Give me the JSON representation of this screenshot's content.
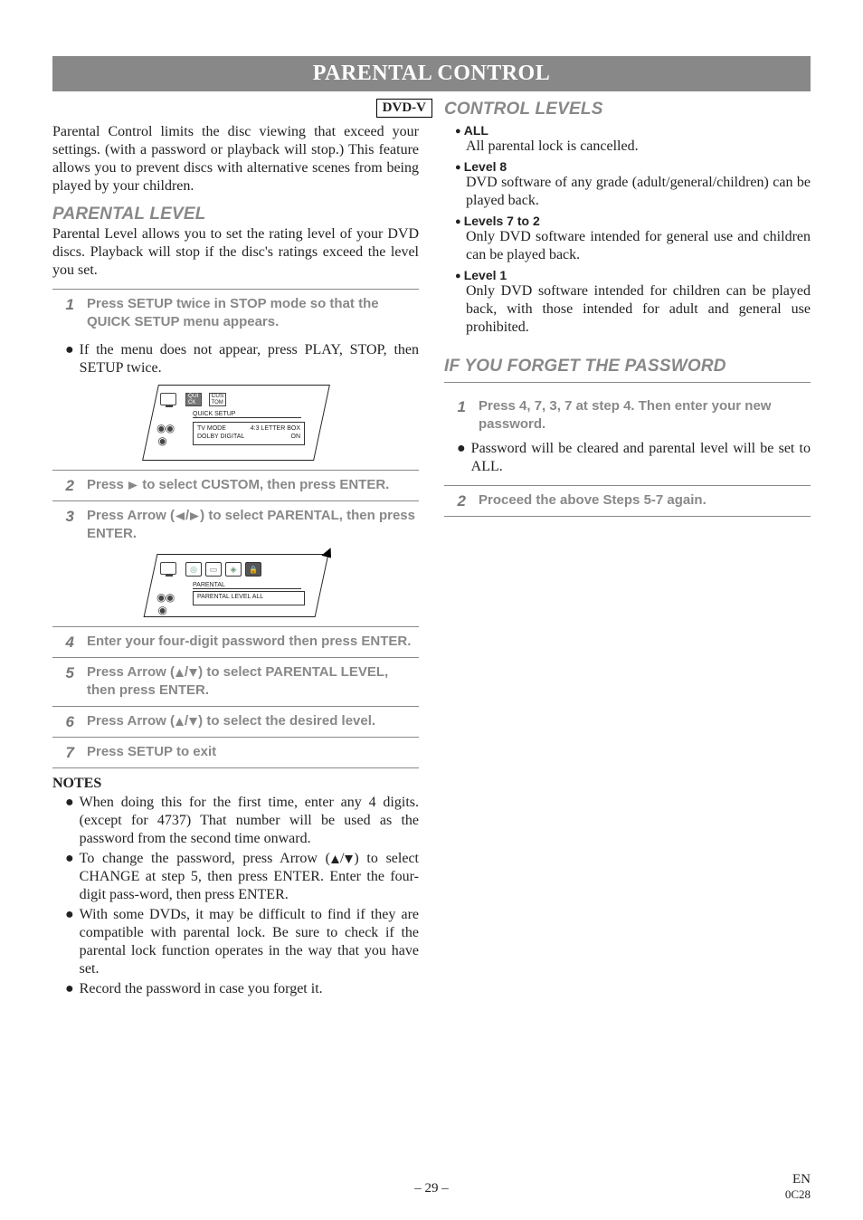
{
  "banner": "PARENTAL CONTROL",
  "dvdv": "DVD-V",
  "intro": "Parental Control limits the disc viewing that exceed your settings. (with a password or playback will stop.) This feature allows you to prevent discs with alternative scenes from being played by your children.",
  "left": {
    "subhead": "PARENTAL LEVEL",
    "subdesc": "Parental Level allows you to set the rating level of your DVD discs. Playback will stop if the disc's ratings exceed the level you set.",
    "step1": "Press SETUP twice in STOP mode so that the QUICK SETUP menu appears.",
    "sub1": "If the menu does not appear, press PLAY, STOP, then SETUP twice.",
    "dia1": {
      "tab1a": "QUI",
      "tab1b": "CK",
      "tab2a": "CUS",
      "tab2b": "TOM",
      "label": "QUICK SETUP",
      "row1a": "TV MODE",
      "row1b": "4:3 LETTER BOX",
      "row2a": "DOLBY DIGITAL",
      "row2b": "ON"
    },
    "step2_pre": "Press ",
    "step2_post": " to select CUSTOM, then press ENTER.",
    "step3_pre": "Press Arrow (",
    "step3_mid": "/",
    "step3_post": ") to select PARENTAL, then press ENTER.",
    "dia2": {
      "label": "PARENTAL",
      "row": "PARENTAL LEVEL    ALL"
    },
    "step4": "Enter your four-digit password then press ENTER.",
    "step5_pre": "Press Arrow (",
    "step5_mid": "/",
    "step5_post": ") to select PARENTAL LEVEL, then press ENTER.",
    "step6_pre": "Press Arrow (",
    "step6_mid": "/",
    "step6_post": ") to select the desired level.",
    "step7": "Press SETUP to exit",
    "notes_head": "NOTES",
    "note1": "When doing this for the first time, enter any 4 digits. (except for 4737) That number will be used as the password from the second time onward.",
    "note2_pre": "To change the password, press Arrow (",
    "note2_mid": "/",
    "note2_post": ") to select CHANGE at step 5, then press ENTER. Enter the four-digit pass-word, then press ENTER.",
    "note3": "With some DVDs, it may be difficult to find if they are compatible with parental lock. Be sure to check if the parental lock function operates in the way that you have set.",
    "note4": "Record the password in case you forget it."
  },
  "right": {
    "subhead1": "CONTROL LEVELS",
    "lvl_all_h": "ALL",
    "lvl_all_d": "All parental lock is cancelled.",
    "lvl_8_h": "Level 8",
    "lvl_8_d": "DVD software of any grade (adult/general/children) can be played back.",
    "lvl_72_h": "Levels 7 to 2",
    "lvl_72_d": "Only DVD software intended for general use and children can be played back.",
    "lvl_1_h": "Level 1",
    "lvl_1_d": "Only DVD software intended for children can be played back, with those intended for adult and general use prohibited.",
    "subhead2": "IF YOU FORGET THE PASSWORD",
    "fp_step1": "Press 4, 7, 3, 7 at step 4. Then enter your new password.",
    "fp_sub": "Password will be cleared and parental level will be set to ALL.",
    "fp_step2": "Proceed the above Steps 5-7 again."
  },
  "footer_center": "– 29 –",
  "footer_right1": "EN",
  "footer_right2": "0C28",
  "nums": {
    "n1": "1",
    "n2": "2",
    "n3": "3",
    "n4": "4",
    "n5": "5",
    "n6": "6",
    "n7": "7"
  }
}
